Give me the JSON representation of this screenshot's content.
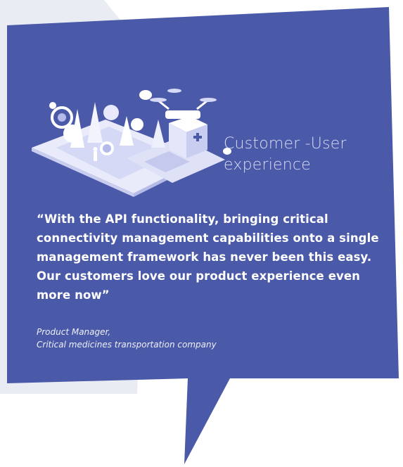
{
  "colors": {
    "card": "#4a59a8",
    "background_shape": "#eaecf3",
    "title": "#d8ddf5",
    "quote": "#ffffff",
    "illustration_base": "#ffffff",
    "illustration_accent": "#b5bbe8"
  },
  "illustration": {
    "icon": "drone-delivery-isometric-illustration"
  },
  "title": {
    "line1": "Customer -User",
    "line2": "experience"
  },
  "testimonial": {
    "quote": "“With the API functionality, bringing critical connectivity management capabilities onto a single management framework has never been this easy. Our customers love our product experience even more now”",
    "author_role": "Product Manager,",
    "author_company": "Critical medicines transportation company"
  }
}
